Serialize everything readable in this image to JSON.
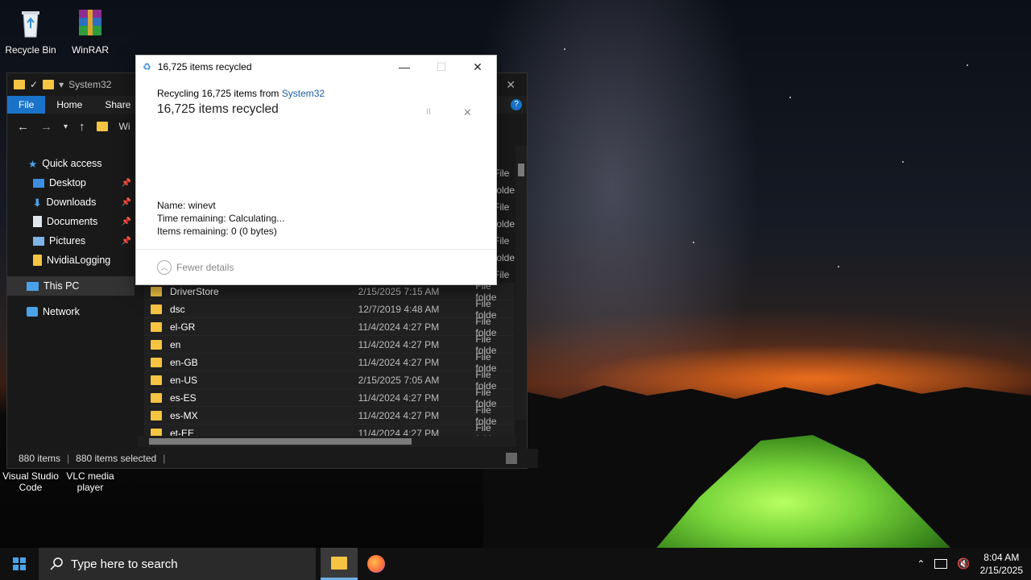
{
  "desktop": {
    "icons": [
      {
        "label": "Recycle Bin",
        "icon": "recycle-bin-icon"
      },
      {
        "label": "WinRAR",
        "icon": "winrar-icon"
      },
      {
        "label": "Visual Studio Code",
        "icon": "vscode-icon"
      },
      {
        "label": "VLC media player",
        "icon": "vlc-icon"
      }
    ]
  },
  "explorer": {
    "title": "System32",
    "ribbon_tabs": [
      "File",
      "Home",
      "Share"
    ],
    "address_partial": "Wi",
    "nav": {
      "quick_access": "Quick access",
      "items": [
        {
          "label": "Desktop",
          "pinned": true
        },
        {
          "label": "Downloads",
          "pinned": true
        },
        {
          "label": "Documents",
          "pinned": true
        },
        {
          "label": "Pictures",
          "pinned": true
        },
        {
          "label": "NvidiaLogging",
          "pinned": false
        }
      ],
      "this_pc": "This PC",
      "network": "Network"
    },
    "partial_type_label": "File folde",
    "files": [
      {
        "name": "DriverStore",
        "date": "2/15/2025 7:15 AM",
        "type": "File folde"
      },
      {
        "name": "dsc",
        "date": "12/7/2019 4:48 AM",
        "type": "File folde"
      },
      {
        "name": "el-GR",
        "date": "11/4/2024 4:27 PM",
        "type": "File folde"
      },
      {
        "name": "en",
        "date": "11/4/2024 4:27 PM",
        "type": "File folde"
      },
      {
        "name": "en-GB",
        "date": "11/4/2024 4:27 PM",
        "type": "File folde"
      },
      {
        "name": "en-US",
        "date": "2/15/2025 7:05 AM",
        "type": "File folde"
      },
      {
        "name": "es-ES",
        "date": "11/4/2024 4:27 PM",
        "type": "File folde"
      },
      {
        "name": "es-MX",
        "date": "11/4/2024 4:27 PM",
        "type": "File folde"
      },
      {
        "name": "et-EE",
        "date": "11/4/2024 4:27 PM",
        "type": "File folde"
      }
    ],
    "status": {
      "count": "880 items",
      "selected": "880 items selected"
    }
  },
  "dialog": {
    "title": "16,725 items recycled",
    "subtitle_prefix": "Recycling 16,725 items from ",
    "subtitle_link": "System32",
    "heading": "16,725 items recycled",
    "name_label": "Name:",
    "name_value": "winevt",
    "time_label": "Time remaining:",
    "time_value": "Calculating...",
    "items_label": "Items remaining:",
    "items_value": "0 (0 bytes)",
    "fewer_details": "Fewer details"
  },
  "taskbar": {
    "search_placeholder": "Type here to search",
    "time": "8:04 AM",
    "date": "2/15/2025"
  },
  "colors": {
    "accent": "#1a73c8",
    "folder": "#f5c443",
    "link": "#1e5ea8"
  }
}
